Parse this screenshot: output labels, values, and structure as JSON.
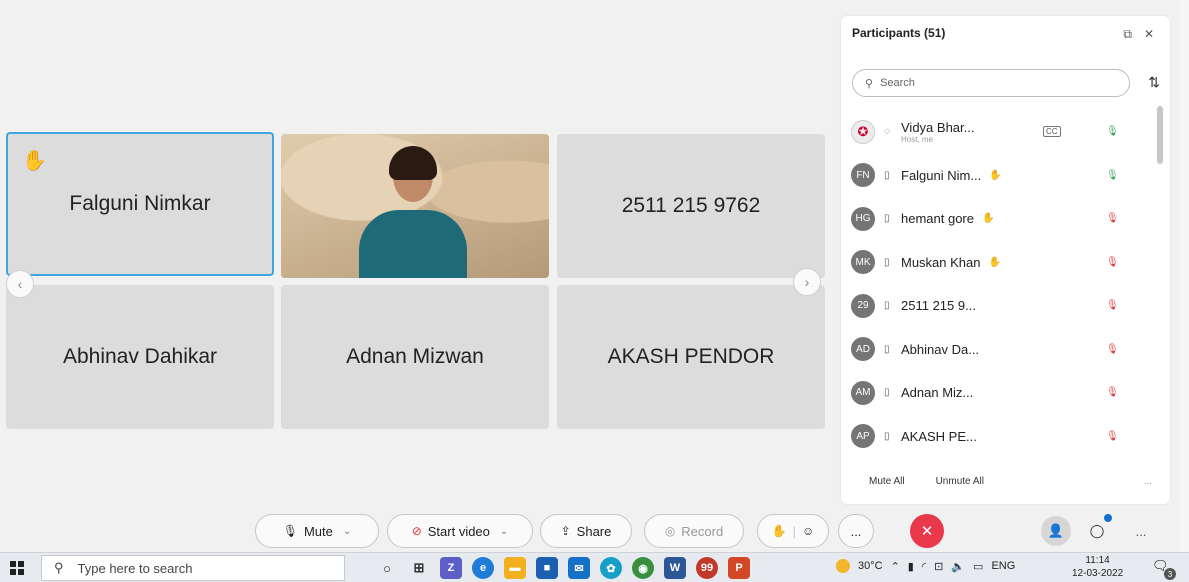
{
  "video_tiles": [
    {
      "name": "Falguni Nimkar",
      "hand_raised": true
    },
    {
      "name": "",
      "video": true
    },
    {
      "name": "2511 215 9762"
    },
    {
      "name": "Abhinav Dahikar"
    },
    {
      "name": "Adnan Mizwan"
    },
    {
      "name": "AKASH PENDOR"
    }
  ],
  "panel": {
    "title": "Participants (51)",
    "search_placeholder": "Search",
    "mute_all": "Mute All",
    "unmute_all": "Unmute All",
    "more": "...",
    "participants": [
      {
        "initials": "",
        "name": "Vidya Bhar...",
        "sub": "Host, me",
        "mic": "on"
      },
      {
        "initials": "FN",
        "name": "Falguni Nim...",
        "mic": "on"
      },
      {
        "initials": "HG",
        "name": "hemant gore",
        "mic": "off"
      },
      {
        "initials": "MK",
        "name": "Muskan Khan",
        "mic": "off"
      },
      {
        "initials": "29",
        "name": "2511 215 9...",
        "mic": "off"
      },
      {
        "initials": "AD",
        "name": "Abhinav Da...",
        "mic": "off"
      },
      {
        "initials": "AM",
        "name": "Adnan Miz...",
        "mic": "off"
      },
      {
        "initials": "AP",
        "name": "AKASH PE...",
        "mic": "off"
      }
    ]
  },
  "toolbar": {
    "mute": "Mute",
    "start_video": "Start video",
    "share": "Share",
    "record": "Record",
    "more": "...",
    "more_right": "..."
  },
  "taskbar": {
    "search_placeholder": "Type here to search",
    "temperature": "30°C",
    "language": "ENG",
    "time": "11:14",
    "date": "12-03-2022",
    "notification_count": "3"
  },
  "colors": {
    "accent_border": "#3da5e0",
    "end_call": "#e8384a",
    "mic_on": "#2aa04a",
    "mic_off": "#d33333"
  }
}
